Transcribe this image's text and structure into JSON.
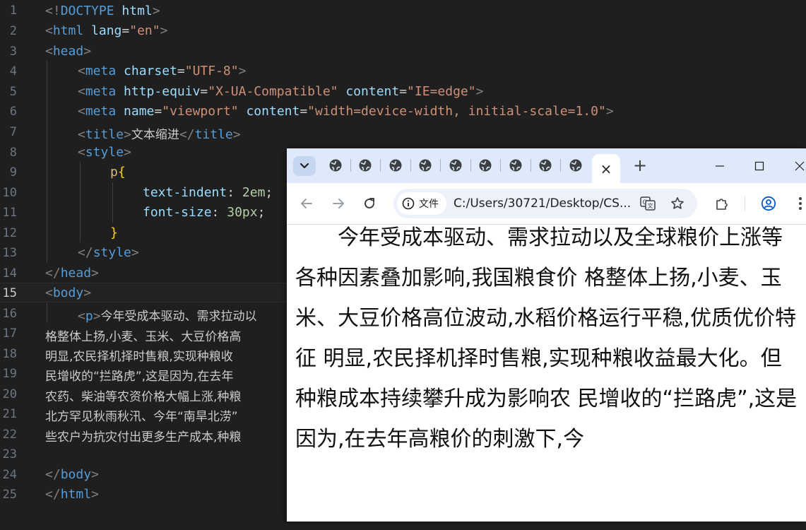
{
  "editor": {
    "current_line": "15",
    "lines": [
      {
        "n": "1"
      },
      {
        "n": "2"
      },
      {
        "n": "3"
      },
      {
        "n": "4"
      },
      {
        "n": "5"
      },
      {
        "n": "6"
      },
      {
        "n": "7"
      },
      {
        "n": "8"
      },
      {
        "n": "9"
      },
      {
        "n": "10"
      },
      {
        "n": "11"
      },
      {
        "n": "12"
      },
      {
        "n": "13"
      },
      {
        "n": "14"
      },
      {
        "n": "15"
      },
      {
        "n": "16"
      },
      {
        "n": "17"
      },
      {
        "n": "18"
      },
      {
        "n": "19"
      },
      {
        "n": "20"
      },
      {
        "n": "21"
      },
      {
        "n": "22"
      },
      {
        "n": "23"
      },
      {
        "n": "24"
      },
      {
        "n": "25"
      }
    ],
    "tokens": {
      "l1": [
        "<!",
        "DOCTYPE",
        " ",
        "html",
        ">"
      ],
      "l2": [
        "<",
        "html",
        " ",
        "lang",
        "=",
        "\"en\"",
        ">"
      ],
      "l3": [
        "<",
        "head",
        ">"
      ],
      "l4": [
        "<",
        "meta",
        " ",
        "charset",
        "=",
        "\"UTF-8\"",
        ">"
      ],
      "l5": [
        "<",
        "meta",
        " ",
        "http-equiv",
        "=",
        "\"X-UA-Compatible\"",
        " ",
        "content",
        "=",
        "\"IE=edge\"",
        ">"
      ],
      "l6": [
        "<",
        "meta",
        " ",
        "name",
        "=",
        "\"viewport\"",
        " ",
        "content",
        "=",
        "\"width=device-width, initial-scale=1.0\"",
        ">"
      ],
      "l7": [
        "<",
        "title",
        ">",
        "文本缩进",
        "</",
        "title",
        ">"
      ],
      "l8": [
        "<",
        "style",
        ">"
      ],
      "l9": [
        "p",
        "{"
      ],
      "l10": [
        "text-indent",
        ": ",
        "2em",
        ";"
      ],
      "l11": [
        "font-size",
        ": ",
        "30px",
        ";"
      ],
      "l12": [
        "}"
      ],
      "l13": [
        "</",
        "style",
        ">"
      ],
      "l14": [
        "</",
        "head",
        ">"
      ],
      "l15": [
        "<",
        "body",
        ">"
      ],
      "l16": [
        "<",
        "p",
        ">",
        "今年受成本驱动、需求拉动以"
      ],
      "l17": "格整体上扬,小麦、玉米、大豆价格高",
      "l18": "明显,农民择机择时售粮,实现种粮收",
      "l19": "民增收的“拦路虎”,这是因为,在去年",
      "l20": "农药、柴油等农资价格大幅上涨,种粮",
      "l21": "北方罕见秋雨秋汛、今年“南旱北涝”",
      "l22": "些农户为抗灾付出更多生产成本,种粮",
      "l24": [
        "</",
        "body",
        ">"
      ],
      "l25": [
        "</",
        "html",
        ">"
      ]
    }
  },
  "browser": {
    "tab_count_inactive": 9,
    "active_tab_close": "×",
    "new_tab": "+",
    "chip_label": "文件",
    "url": "C:/Users/30721/Desktop/CS...",
    "colors": {
      "tabbar": "#dee9fb",
      "omnibox": "#edf2fa",
      "accent": "#0b57d0"
    },
    "page_text": "今年受成本驱动、需求拉动以及全球粮价上涨等各种因素叠加影响,我国粮食价 格整体上扬,小麦、玉米、大豆价格高位波动,水稻价格运行平稳,优质优价特征 明显,农民择机择时售粮,实现种粮收益最大化。但种粮成本持续攀升成为影响农 民增收的“拦路虎”,这是因为,在去年高粮价的刺激下,今"
  }
}
